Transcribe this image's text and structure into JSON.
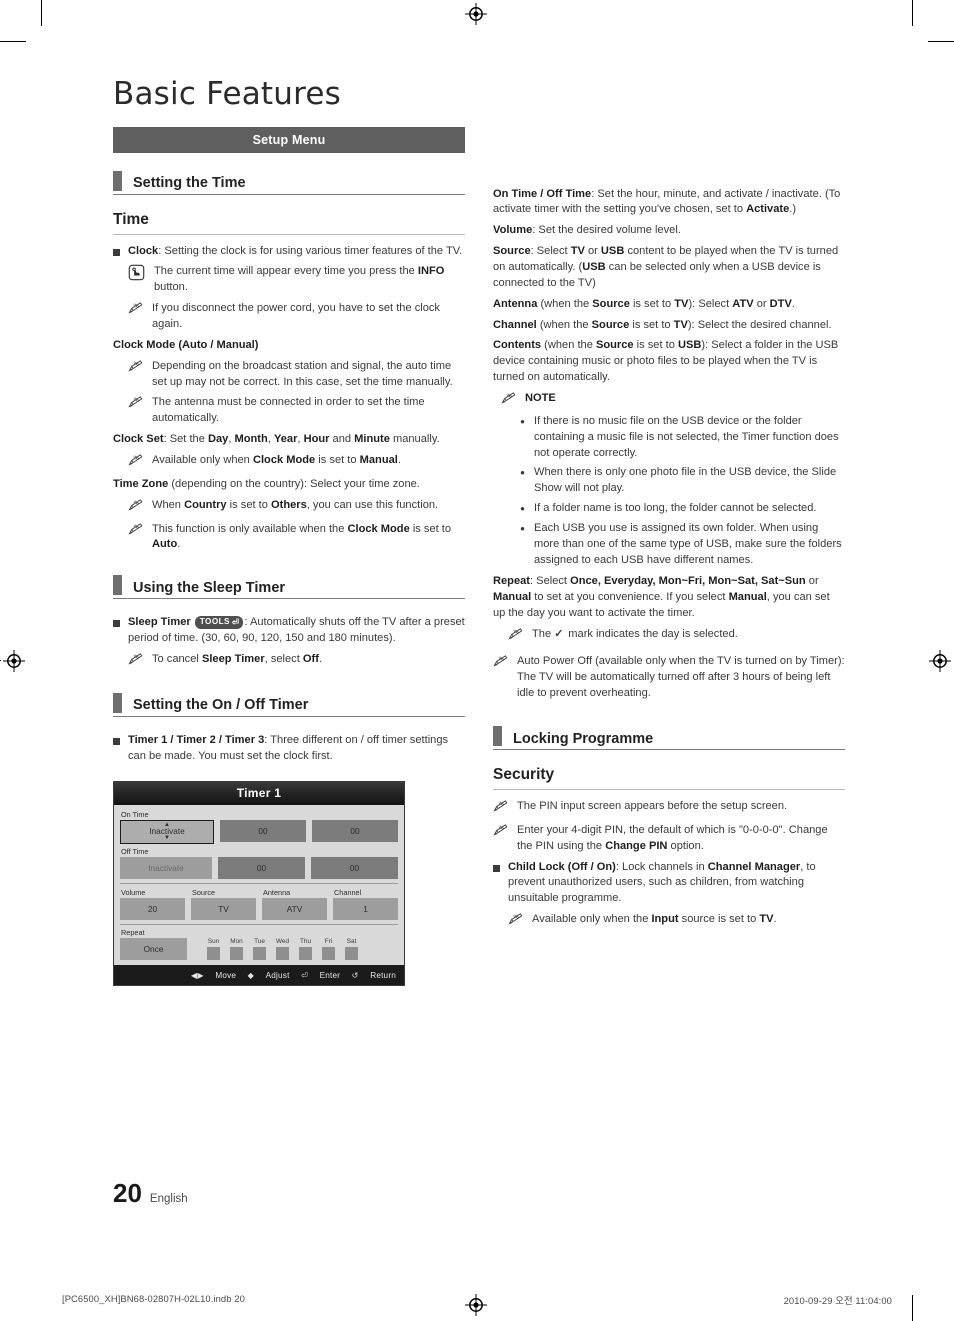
{
  "document": {
    "title": "Basic Features",
    "menu_bar": "Setup Menu",
    "page_number": "20",
    "language": "English",
    "footer_left": "[PC6500_XH]BN68-02807H-02L10.indb   20",
    "footer_right": "2010-09-29   오전 11:04:00"
  },
  "left_column": {
    "section_heading": "Setting the Time",
    "sub_heading": "Time",
    "clock_label": "Clock",
    "clock_text": ": Setting the clock is for using various timer features of the TV.",
    "hand_note": "The current time will appear every time you press the INFO button.",
    "note_power_cord": "If you disconnect the power cord, you have to set the clock again.",
    "clock_mode_heading": "Clock Mode (Auto / Manual)",
    "note_broadcast": "Depending on the broadcast station and signal, the auto time set up may not be correct. In this case, set the time manually.",
    "note_antenna": "The antenna must be connected in order to set the time automatically.",
    "clock_set_label": "Clock Set",
    "clock_set_text": ": Set the Day, Month, Year, Hour and Minute manually.",
    "note_clock_mode_manual": "Available only when Clock Mode is set to Manual.",
    "time_zone_label": "Time Zone",
    "time_zone_text": " (depending on the country): Select your time zone.",
    "note_country_others": "When Country is set to Others, you can use this function.",
    "note_clock_mode_auto": "This function is only available when the Clock Mode is set to Auto.",
    "sleep_section_heading": "Using the Sleep Timer",
    "sleep_timer_label": "Sleep Timer",
    "tools_badge": "TOOLS",
    "sleep_timer_text": ": Automatically shuts off the TV after a preset period of time. (30, 60, 90, 120, 150 and 180 minutes).",
    "note_cancel_sleep": "To cancel Sleep Timer, select Off.",
    "onoff_section_heading": "Setting the On / Off Timer",
    "timer_label": "Timer 1 / Timer 2 / Timer 3",
    "timer_text": ": Three different on / off timer settings can be made. You must set the clock first."
  },
  "osd": {
    "title": "Timer 1",
    "on_time_label": "On Time",
    "off_time_label": "Off Time",
    "on_time_state": "Inactivate",
    "on_time_hour": "00",
    "on_time_minute": "00",
    "off_time_state": "Inactivate",
    "off_time_hour": "00",
    "off_time_minute": "00",
    "volume_label": "Volume",
    "volume_value": "20",
    "source_label": "Source",
    "source_value": "TV",
    "antenna_label": "Antenna",
    "antenna_value": "ATV",
    "channel_label": "Channel",
    "channel_value": "1",
    "repeat_label": "Repeat",
    "repeat_value": "Once",
    "days": [
      "Sun",
      "Mon",
      "Tue",
      "Wed",
      "Thu",
      "Fri",
      "Sat"
    ],
    "footer": {
      "move": "Move",
      "adjust": "Adjust",
      "enter": "Enter",
      "return": "Return"
    }
  },
  "right_column": {
    "on_off_time_label": "On Time / Off Time",
    "on_off_time_text": ": Set the hour, minute, and activate / inactivate. (To activate timer with the setting you've chosen, set to Activate.)",
    "volume_label": "Volume",
    "volume_text": ": Set the desired volume level.",
    "source_label": "Source",
    "source_text": ": Select TV or USB content to be played when the TV is turned on automatically. (USB can be selected only when a USB device is connected to the TV)",
    "antenna_label": "Antenna",
    "antenna_text": " (when the Source is set to TV): Select ATV or DTV.",
    "channel_label": "Channel",
    "channel_text": " (when the Source is set to TV): Select the desired channel.",
    "contents_label": "Contents",
    "contents_text": " (when the Source is set to USB): Select a folder in the USB device containing music or photo files to be played when the TV is turned on automatically.",
    "note_heading": "NOTE",
    "note_bullets": [
      "If there is no music file on the USB device or the folder containing a music file is not selected, the Timer function does not operate correctly.",
      "When there is only one photo file in the USB device, the Slide Show will not play.",
      "If a folder name is too long, the folder cannot be selected.",
      "Each USB you use is assigned its own folder. When using more than one of the same type of USB, make sure the folders assigned to each USB have different names."
    ],
    "repeat_label": "Repeat",
    "repeat_text": ": Select Once, Everyday, Mon~Fri, Mon~Sat, Sat~Sun or Manual to set at you convenience. If you select Manual, you can set up the day you want to activate the timer.",
    "note_check_mark": "The ✓ mark indicates the day is selected.",
    "note_auto_power_off": "Auto Power Off (available only when the TV is turned on by Timer): The TV will be automatically turned off after 3 hours of being left idle to prevent overheating.",
    "locking_section_heading": "Locking Programme",
    "security_sub_heading": "Security",
    "note_pin_screen": "The PIN input screen appears before the setup screen.",
    "note_pin_default": "Enter your 4-digit PIN, the default of which is \"0-0-0-0\". Change the PIN using the Change PIN option.",
    "child_lock_label": "Child Lock (Off / On)",
    "child_lock_text": ": Lock channels in Channel Manager, to prevent unauthorized users, such as children, from watching unsuitable programme.",
    "note_input_tv": "Available only when the Input source is set to TV."
  },
  "colors": {
    "menu_bar_bg": "#5f5f5f",
    "section_tab": "#6f6f6f",
    "osd_bg": "#d9d9d9",
    "osd_title_bg": "#262626"
  }
}
